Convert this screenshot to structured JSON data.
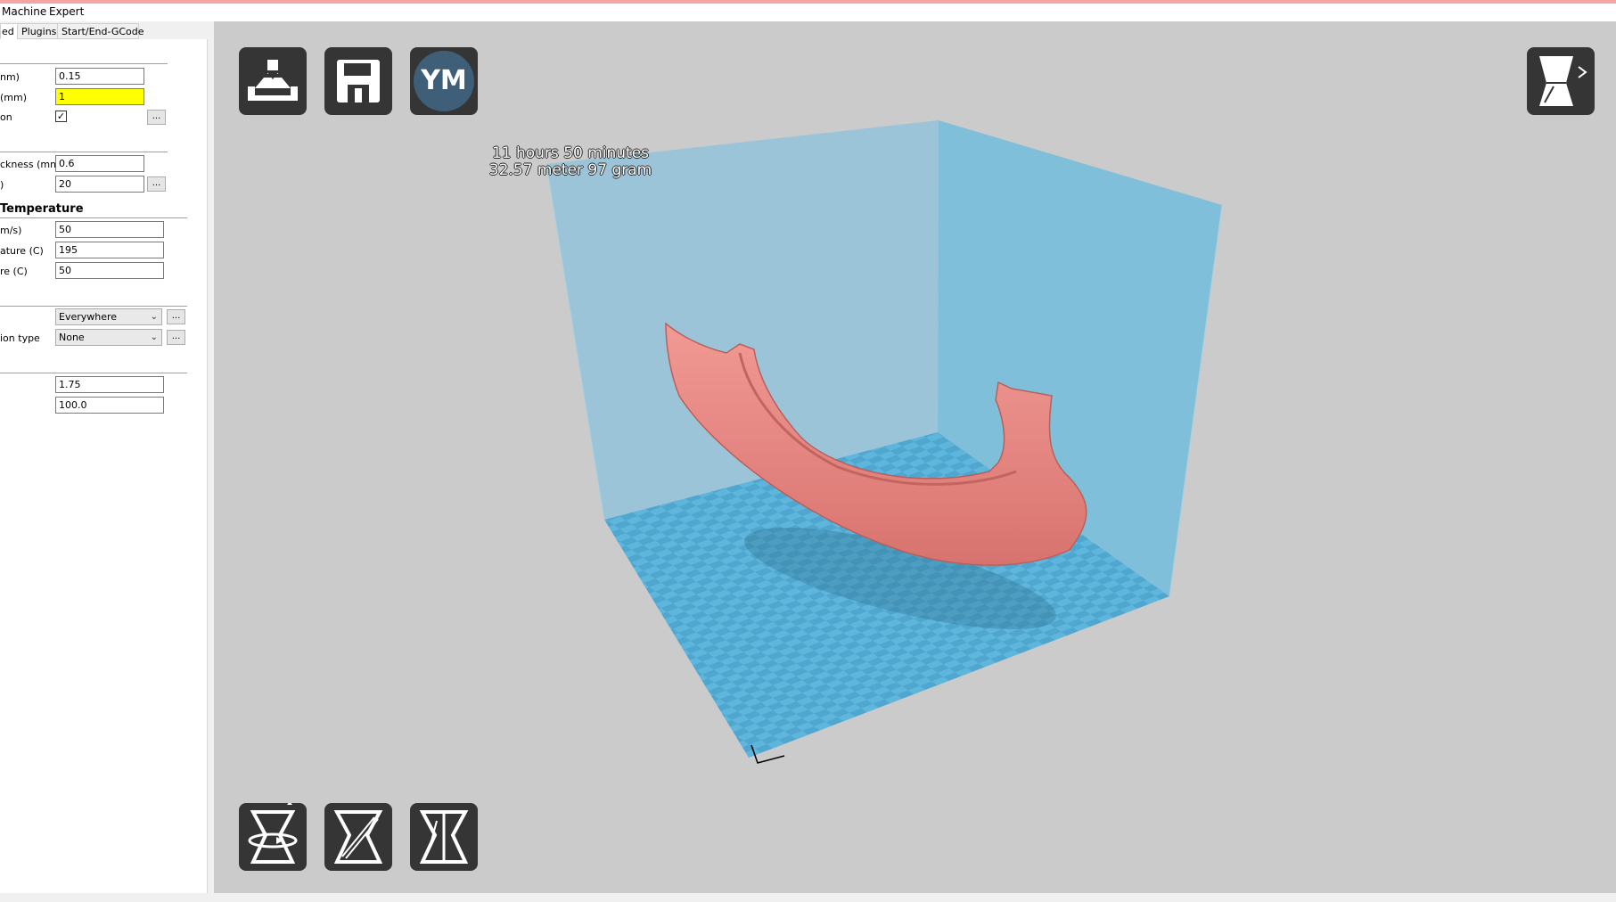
{
  "menu": {
    "machine": "Machine",
    "expert": "Expert"
  },
  "tabs": [
    "ed",
    "Plugins",
    "Start/End-GCode"
  ],
  "settings": {
    "layer_height": {
      "label": "nm)",
      "value": "0.15"
    },
    "shell": {
      "label": "(mm)",
      "value": "1"
    },
    "retraction": {
      "label": "on"
    },
    "bottom_top": {
      "label": "ckness (mm)",
      "value": "0.6"
    },
    "fill_density": {
      "label": ")",
      "value": "20"
    },
    "speed_section": "Temperature",
    "print_speed": {
      "label": "m/s)",
      "value": "50"
    },
    "print_temp": {
      "label": "ature (C)",
      "value": "195"
    },
    "bed_temp": {
      "label": "re (C)",
      "value": "50"
    },
    "support_type": {
      "value": "Everywhere"
    },
    "adhesion_type": {
      "label": "ion type",
      "value": "None"
    },
    "diameter": {
      "value": "1.75"
    },
    "flow": {
      "value": "100.0"
    },
    "dots": "..."
  },
  "viewport": {
    "print_time": "11 hours 50 minutes",
    "print_material": "32.57 meter 97 gram",
    "ym_button": "YM"
  },
  "colors": {
    "volume_blue": "#7fbfdc",
    "model_pink": "#ef8a86",
    "viewport_bg": "#cbcbcb",
    "button_bg": "#353535"
  }
}
